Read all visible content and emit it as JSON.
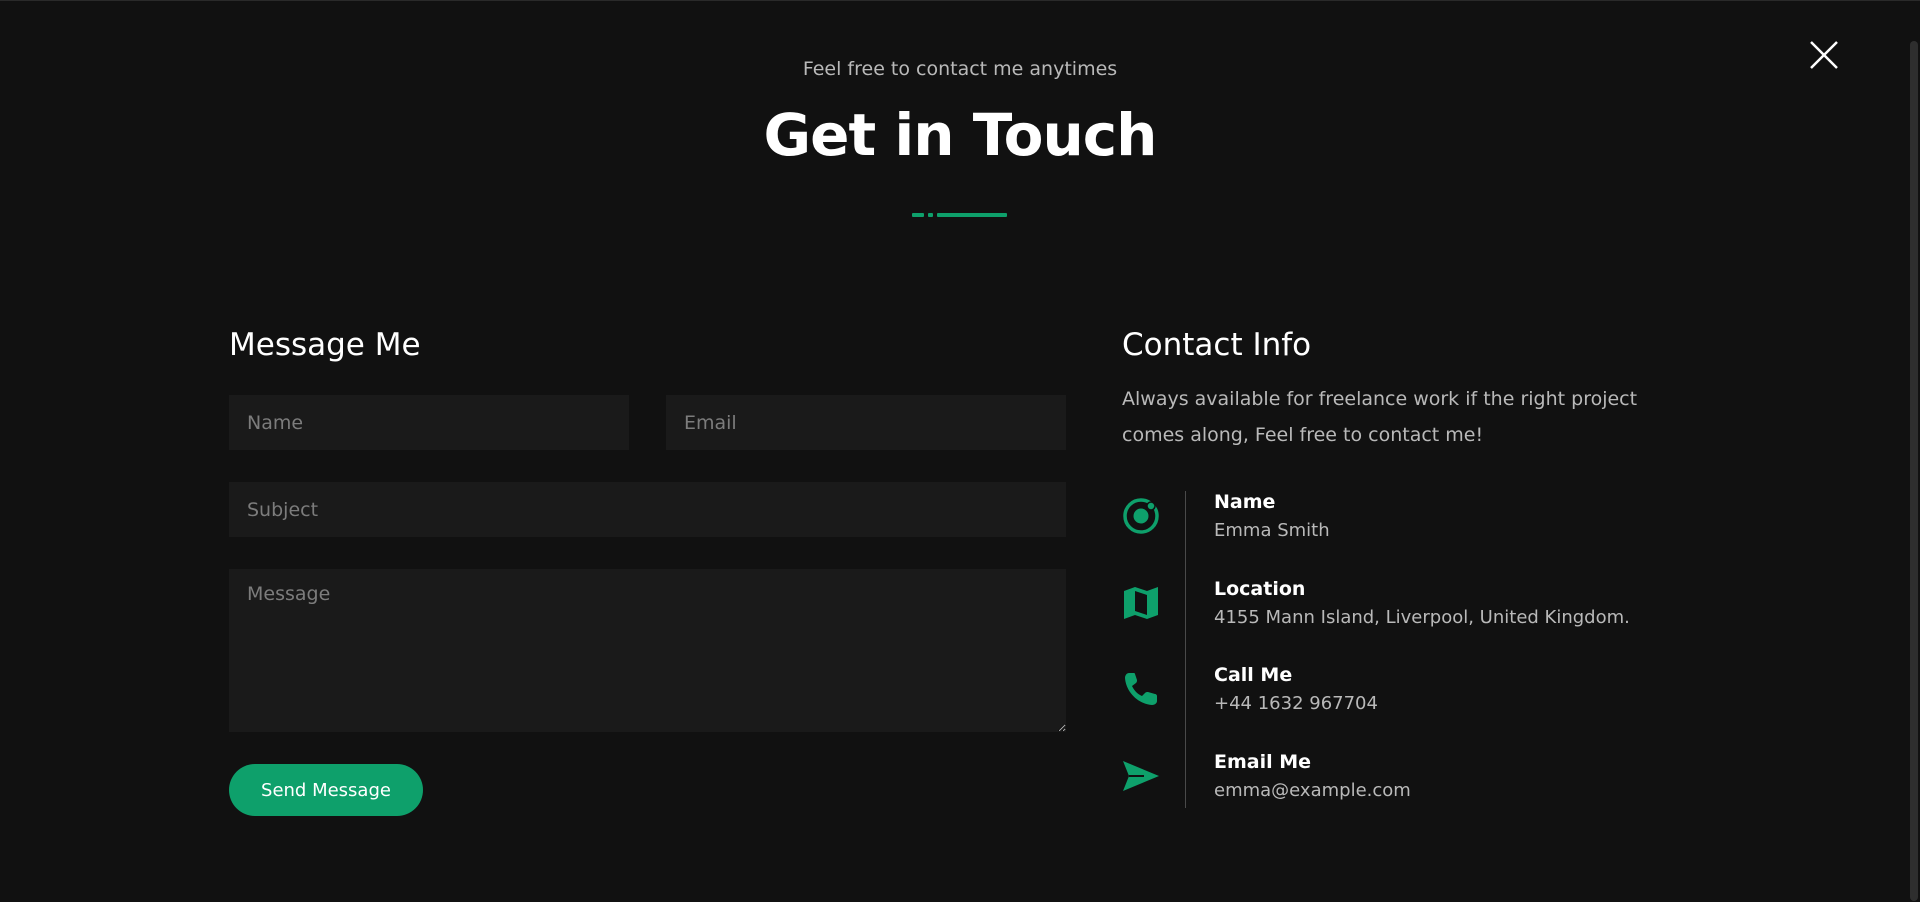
{
  "header": {
    "subtitle": "Feel free to contact me anytimes",
    "title": "Get in Touch"
  },
  "accent_color": "#0ea06b",
  "message_form": {
    "heading": "Message Me",
    "name_placeholder": "Name",
    "email_placeholder": "Email",
    "subject_placeholder": "Subject",
    "message_placeholder": "Message",
    "send_label": "Send Message"
  },
  "contact_info": {
    "heading": "Contact Info",
    "description": "Always available for freelance work if the right project comes along, Feel free to contact me!",
    "items": [
      {
        "icon": "radio-target-icon",
        "label": "Name",
        "value": "Emma Smith"
      },
      {
        "icon": "map-icon",
        "label": "Location",
        "value": "4155 Mann Island, Liverpool, United Kingdom."
      },
      {
        "icon": "phone-icon",
        "label": "Call Me",
        "value": "+44 1632 967704"
      },
      {
        "icon": "send-icon",
        "label": "Email Me",
        "value": "emma@example.com"
      }
    ]
  }
}
